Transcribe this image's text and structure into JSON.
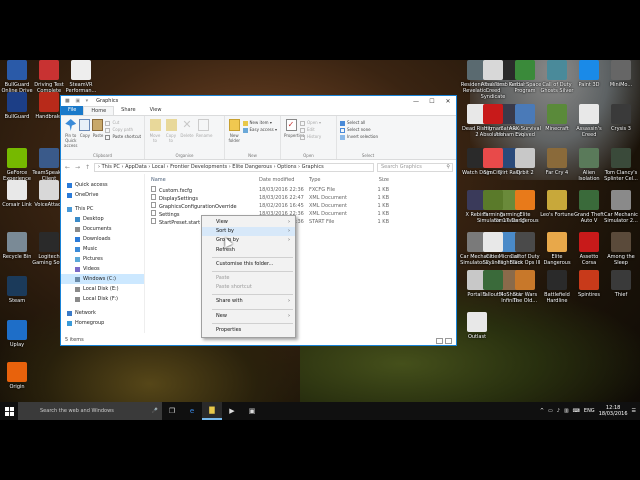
{
  "desktop": {
    "left_icons": [
      {
        "label": "BullGuard Online Drive",
        "color": "#2a5aa8"
      },
      {
        "label": "Driving Test Complete",
        "color": "#c83232"
      },
      {
        "label": "SteamVR Performan...",
        "color": "#eeeeee"
      },
      {
        "label": "BullGuard",
        "color": "#1c3e86"
      },
      {
        "label": "Handbrake",
        "color": "#b82a1a"
      },
      {
        "label": "GeForce Experience",
        "color": "#76b900"
      },
      {
        "label": "TeamSpeak 3 Client",
        "color": "#3a5a8a"
      },
      {
        "label": "Corsair Link",
        "color": "#e8e8e8"
      },
      {
        "label": "VoiceAttack",
        "color": "#d8d8d8"
      },
      {
        "label": "Recycle Bin",
        "color": "#7a8a96"
      },
      {
        "label": "Logitech Gaming Sof...",
        "color": "#2a2a2a"
      },
      {
        "label": "Steam",
        "color": "#1b3a5a"
      },
      {
        "label": "Uplay",
        "color": "#1e6ec8"
      },
      {
        "label": "Origin",
        "color": "#e8620c"
      }
    ],
    "right_icons": [
      {
        "label": "Resident Evil Revelatio...",
        "color": "#5a6a70"
      },
      {
        "label": "Tomb Raider",
        "color": "#2a2a2a"
      },
      {
        "label": "Assassins Creed Syndicate",
        "color": "#d8d8d8"
      },
      {
        "label": "Kerbal Space Program",
        "color": "#3a8a3a"
      },
      {
        "label": "Call of Duty Ghosts Silver",
        "color": "#4a8a9a"
      },
      {
        "label": "Paint 3D",
        "color": "#1a8ae8"
      },
      {
        "label": "MiniMo...",
        "color": "#666666"
      },
      {
        "label": "Dead Rising 2",
        "color": "#e8e8e8"
      },
      {
        "label": "Batman Arkham City",
        "color": "#3a3a4a"
      },
      {
        "label": "Hitman Absolution",
        "color": "#c81a1a"
      },
      {
        "label": "ARK Survival Evolved",
        "color": "#4a7ab8"
      },
      {
        "label": "Minecraft",
        "color": "#5a8a3a"
      },
      {
        "label": "Assassin's Creed",
        "color": "#e8e8e8"
      },
      {
        "label": "Crysis 3",
        "color": "#3a3a3a"
      },
      {
        "label": "Watch Dogs",
        "color": "#2a2a2a"
      },
      {
        "label": "Dirt Rally",
        "color": "#2a4a7a"
      },
      {
        "label": "SimCity",
        "color": "#e84a4a"
      },
      {
        "label": "Orbit 2",
        "color": "#c8c8c8"
      },
      {
        "label": "Far Cry 4",
        "color": "#8a6a3a"
      },
      {
        "label": "Alien Isolation",
        "color": "#5a7a5a"
      },
      {
        "label": "Tom Clancy's Splinter Cel...",
        "color": "#3a4a3a"
      },
      {
        "label": "X Rebirth",
        "color": "#3a3a5a"
      },
      {
        "label": "Farming Simulator 15",
        "color": "#6a8a3a"
      },
      {
        "label": "Farming Simulator 17",
        "color": "#5a7a2a"
      },
      {
        "label": "Elite Dangerous",
        "color": "#e87a1a"
      },
      {
        "label": "Leo's Fortune",
        "color": "#c8a83a"
      },
      {
        "label": "Grand Theft Auto V",
        "color": "#3a6a3a"
      },
      {
        "label": "Car Mechanic Simulator 2...",
        "color": "#8a8a8a"
      },
      {
        "label": "Car Mechanic Simulator 2...",
        "color": "#7a7a7a"
      },
      {
        "label": "Microsoft Flight Sim",
        "color": "#4a8ac8"
      },
      {
        "label": "Cities Skylines",
        "color": "#e8e8e8"
      },
      {
        "label": "Call of Duty Black Ops III",
        "color": "#4a4a4a"
      },
      {
        "label": "Elite Dangerous",
        "color": "#e8a84a"
      },
      {
        "label": "Assetto Corsa",
        "color": "#c81a1a"
      },
      {
        "label": "Among the Sleep",
        "color": "#5a4a3a"
      },
      {
        "label": "Portal 2",
        "color": "#c8c8c8"
      },
      {
        "label": "BioShock Infinite",
        "color": "#8a6a4a"
      },
      {
        "label": "Fallout 4",
        "color": "#3a6a3a"
      },
      {
        "label": "Star Wars The Old...",
        "color": "#c8782a"
      },
      {
        "label": "Battlefield Hardline",
        "color": "#2a2a2a"
      },
      {
        "label": "Spintires",
        "color": "#c83a1a"
      },
      {
        "label": "Thief",
        "color": "#3a3a3a"
      },
      {
        "label": "Outlast",
        "color": "#e8e8e8"
      }
    ]
  },
  "explorer": {
    "title": "Graphics",
    "qat_glyphs": "■ ▣ ▾",
    "window_buttons": {
      "minimize": "—",
      "maximize": "☐",
      "close": "✕"
    },
    "ribbon_tabs": [
      "File",
      "Home",
      "Share",
      "View"
    ],
    "ribbon": {
      "clipboard": {
        "group": "Clipboard",
        "pin": "Pin to Quick access",
        "copy": "Copy",
        "paste": "Paste",
        "cut": "Cut",
        "copy_path": "Copy path",
        "paste_shortcut": "Paste shortcut"
      },
      "organise": {
        "group": "Organise",
        "move_to": "Move to",
        "copy_to": "Copy to",
        "delete": "Delete",
        "rename": "Rename"
      },
      "new": {
        "group": "New",
        "new_folder": "New folder",
        "new_item": "New item ▾",
        "easy_access": "Easy access ▾"
      },
      "open": {
        "group": "Open",
        "properties": "Properties",
        "open": "Open ▾",
        "edit": "Edit",
        "history": "History"
      },
      "select": {
        "group": "Select",
        "select_all": "Select all",
        "select_none": "Select none",
        "invert": "Invert selection"
      }
    },
    "nav": {
      "back": "←",
      "forward": "→",
      "up": "↑"
    },
    "address": "›  This PC  ›  AppData  ›  Local  ›  Frontier Developments  ›  Elite Dangerous  ›  Options  ›  Graphics",
    "search_placeholder": "Search Graphics",
    "search_icon": "⚲",
    "navpane": [
      {
        "label": "Quick access",
        "icon": "star-icon",
        "color": "#2a7ad8",
        "indent": 0
      },
      {
        "label": "OneDrive",
        "icon": "cloud-icon",
        "color": "#2a7ad8",
        "indent": 0
      },
      {
        "label": "This PC",
        "icon": "computer-icon",
        "color": "#4a9ad8",
        "indent": 0
      },
      {
        "label": "Desktop",
        "icon": "desktop-icon",
        "color": "#3a8ac8",
        "indent": 1
      },
      {
        "label": "Documents",
        "icon": "documents-icon",
        "color": "#8a8a8a",
        "indent": 1
      },
      {
        "label": "Downloads",
        "icon": "download-icon",
        "color": "#2a7ad8",
        "indent": 1
      },
      {
        "label": "Music",
        "icon": "music-icon",
        "color": "#3a8ad8",
        "indent": 1
      },
      {
        "label": "Pictures",
        "icon": "pictures-icon",
        "color": "#5aa8d8",
        "indent": 1
      },
      {
        "label": "Videos",
        "icon": "videos-icon",
        "color": "#7a6ac8",
        "indent": 1
      },
      {
        "label": "Windows (C:)",
        "icon": "drive-icon",
        "color": "#6a8aa8",
        "indent": 1,
        "selected": true
      },
      {
        "label": "Local Disk (E:)",
        "icon": "drive-icon",
        "color": "#8a8a8a",
        "indent": 1
      },
      {
        "label": "Local Disk (F:)",
        "icon": "drive-icon",
        "color": "#8a8a8a",
        "indent": 1
      },
      {
        "label": "Network",
        "icon": "network-icon",
        "color": "#3a7ac8",
        "indent": 0
      },
      {
        "label": "Homegroup",
        "icon": "homegroup-icon",
        "color": "#3a9ad8",
        "indent": 0
      }
    ],
    "columns": {
      "name": "Name",
      "date": "Date modified",
      "type": "Type",
      "size": "Size"
    },
    "files": [
      {
        "name": "Custom.fxcfg",
        "date": "18/03/2016 22:36",
        "type": "FXCFG File",
        "size": "1 KB"
      },
      {
        "name": "DisplaySettings",
        "date": "18/03/2016 22:47",
        "type": "XML Document",
        "size": "1 KB"
      },
      {
        "name": "GraphicsConfigurationOverride",
        "date": "18/02/2016 16:45",
        "type": "XML Document",
        "size": "1 KB"
      },
      {
        "name": "Settings",
        "date": "18/03/2016 22:36",
        "type": "XML Document",
        "size": "1 KB"
      },
      {
        "name": "StartPreset.start",
        "date": "18/03/2016 22:36",
        "type": "START File",
        "size": "1 KB"
      }
    ],
    "status": "5 items"
  },
  "context_menu": {
    "items": [
      {
        "label": "View",
        "submenu": true,
        "disabled": false
      },
      {
        "label": "Sort by",
        "submenu": true,
        "disabled": false,
        "highlight": true
      },
      {
        "label": "Group by",
        "submenu": true,
        "disabled": false
      },
      {
        "label": "Refresh",
        "submenu": false,
        "disabled": false
      },
      {
        "sep": true
      },
      {
        "label": "Customise this folder...",
        "submenu": false,
        "disabled": false
      },
      {
        "sep": true
      },
      {
        "label": "Paste",
        "submenu": false,
        "disabled": true
      },
      {
        "label": "Paste shortcut",
        "submenu": false,
        "disabled": true
      },
      {
        "sep": true
      },
      {
        "label": "Share with",
        "submenu": true,
        "disabled": false
      },
      {
        "sep": true
      },
      {
        "label": "New",
        "submenu": true,
        "disabled": false
      },
      {
        "sep": true
      },
      {
        "label": "Properties",
        "submenu": false,
        "disabled": false
      }
    ],
    "arrow": "›"
  },
  "taskbar": {
    "search_placeholder": "Search the web and Windows",
    "mic_icon": "🎤",
    "apps": [
      {
        "name": "task-view",
        "glyph": "❐",
        "color": "#dddddd"
      },
      {
        "name": "edge",
        "glyph": "e",
        "color": "#3a8ae8"
      },
      {
        "name": "file-explorer",
        "glyph": "▇",
        "color": "#e8c84a",
        "active": true
      },
      {
        "name": "video-app",
        "glyph": "▶",
        "color": "#dddddd"
      },
      {
        "name": "store",
        "glyph": "▣",
        "color": "#dddddd"
      }
    ],
    "tray_glyphs": [
      "^",
      "▭",
      "♪",
      "▥",
      "⌨"
    ],
    "language": "ENG",
    "time": "12:18",
    "date": "18/03/2016",
    "notification_glyph": "☰"
  }
}
